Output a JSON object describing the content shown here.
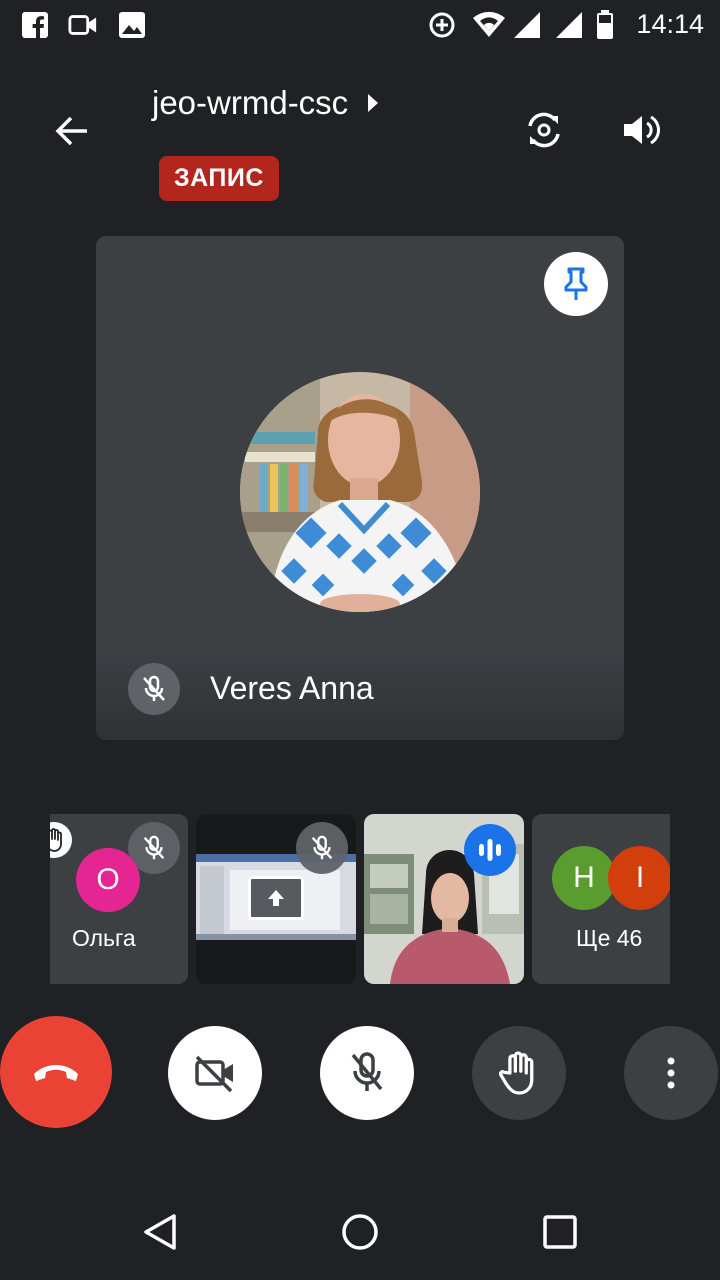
{
  "status_bar": {
    "time": "14:14",
    "icons": [
      "facebook-icon",
      "video-camera-icon",
      "gallery-icon",
      "data-saver-icon",
      "wifi-icon",
      "signal-icon",
      "signal-icon",
      "battery-icon"
    ]
  },
  "header": {
    "meeting_code": "jeo-wrmd-csc",
    "recording_label": "ЗАПИС"
  },
  "main_tile": {
    "participant_name": "Veres Anna",
    "mic_muted": true,
    "pinned": true
  },
  "thumbnails": [
    {
      "type": "avatar",
      "initial": "О",
      "name": "Ольга",
      "color": "#e52592",
      "hand_raised": true,
      "mic_muted": true
    },
    {
      "type": "screen-share",
      "mic_muted": true
    },
    {
      "type": "video",
      "speaking": true
    },
    {
      "type": "overflow",
      "initials": [
        "Н",
        "І"
      ],
      "colors": [
        "#5a9d2e",
        "#d23f0d"
      ],
      "label": "Ще 46"
    }
  ],
  "colors": {
    "background": "#202124",
    "tile": "#3c4043",
    "end_call": "#ea4335",
    "recording": "#b3261e",
    "accent_blue": "#1a73e8"
  }
}
